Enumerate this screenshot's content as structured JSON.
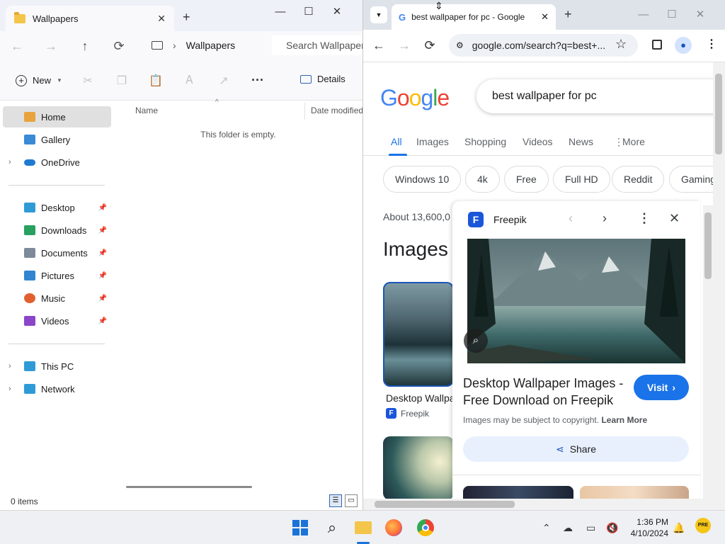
{
  "explorer": {
    "tab_title": "Wallpapers",
    "new_tab_symbol": "+",
    "window_controls": {
      "minimize": "—",
      "maximize": "☐",
      "close": "✕"
    },
    "breadcrumb": "Wallpapers",
    "search_placeholder": "Search Wallpapers",
    "toolbar": {
      "new_label": "New",
      "details_label": "Details"
    },
    "sidebar": {
      "quick": [
        {
          "label": "Home",
          "color": "#e8a33c"
        },
        {
          "label": "Gallery",
          "color": "#3a8ad6"
        },
        {
          "label": "OneDrive",
          "color": "#1e7ad1"
        }
      ],
      "pinned": [
        {
          "label": "Desktop",
          "color": "#2f9bd6"
        },
        {
          "label": "Downloads",
          "color": "#28a060"
        },
        {
          "label": "Documents",
          "color": "#7d8a9a"
        },
        {
          "label": "Pictures",
          "color": "#3285d0"
        },
        {
          "label": "Music",
          "color": "#e2602f"
        },
        {
          "label": "Videos",
          "color": "#8b45c9"
        }
      ],
      "devices": [
        {
          "label": "This PC",
          "color": "#2f9bd6"
        },
        {
          "label": "Network",
          "color": "#2f9bd6"
        }
      ]
    },
    "columns": {
      "name": "Name",
      "date_modified": "Date modified"
    },
    "empty_message": "This folder is empty.",
    "status": "0 items"
  },
  "chrome": {
    "tab_title": "best wallpaper for pc - Google",
    "url": "google.com/search?q=best+...",
    "google": {
      "logo_letters": [
        "G",
        "o",
        "o",
        "g",
        "l",
        "e"
      ],
      "logo_colors": [
        "#4285f4",
        "#ea4335",
        "#fbbc05",
        "#4285f4",
        "#34a853",
        "#ea4335"
      ],
      "query": "best wallpaper for pc",
      "tabs": [
        "All",
        "Images",
        "Shopping",
        "Videos",
        "News",
        "More"
      ],
      "chips": [
        "Windows 10",
        "4k",
        "Free",
        "Full HD",
        "Reddit",
        "Gaming"
      ],
      "about": "About 13,600,0",
      "images_heading": "Images",
      "result": {
        "title": "Desktop Wallpa",
        "source": "Freepik"
      }
    },
    "panel": {
      "site": "Freepik",
      "logo_letter": "F",
      "title": "Desktop Wallpaper Images - Free Download on Freepik",
      "visit_label": "Visit",
      "note_text": "Images may be subject to copyright.",
      "note_link": "Learn More",
      "share_label": "Share"
    }
  },
  "taskbar": {
    "time": "1:36 PM",
    "date": "4/10/2024",
    "badge": "PRE"
  }
}
